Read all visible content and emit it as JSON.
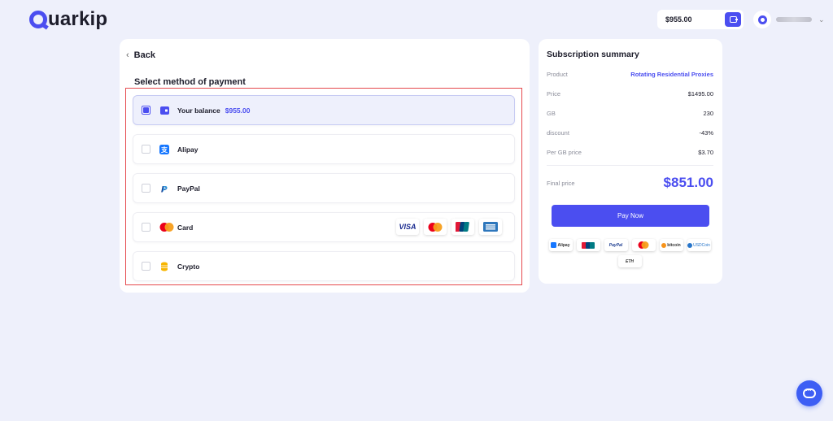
{
  "header": {
    "logo_text": "uarkip",
    "balance": "$955.00"
  },
  "back_label": "Back",
  "payment": {
    "title": "Select method of payment",
    "options": [
      {
        "label": "Your balance",
        "amount": "$955.00",
        "selected": true
      },
      {
        "label": "Alipay",
        "selected": false
      },
      {
        "label": "PayPal",
        "selected": false
      },
      {
        "label": "Card",
        "selected": false
      },
      {
        "label": "Crypto",
        "selected": false
      }
    ],
    "card_logos": [
      "VISA",
      "Mastercard",
      "UnionPay",
      "American Express"
    ]
  },
  "summary": {
    "title": "Subscription summary",
    "rows": [
      {
        "key": "Product",
        "value": "Rotating Residential Proxies"
      },
      {
        "key": "Price",
        "value": "$1495.00"
      },
      {
        "key": "GB",
        "value": "230"
      },
      {
        "key": "discount",
        "value": "-43%"
      },
      {
        "key": "Per GB price",
        "value": "$3.70"
      }
    ],
    "final_label": "Final price",
    "final_value": "$851.00",
    "pay_button": "Pay Now",
    "badges": [
      "Alipay",
      "UnionPay",
      "PayPal",
      "Mastercard",
      "bitcoin",
      "USDCoin",
      "ETH"
    ]
  },
  "colors": {
    "accent": "#4b4ef0",
    "background": "#eef0fb",
    "highlight_border": "#e5494d"
  }
}
